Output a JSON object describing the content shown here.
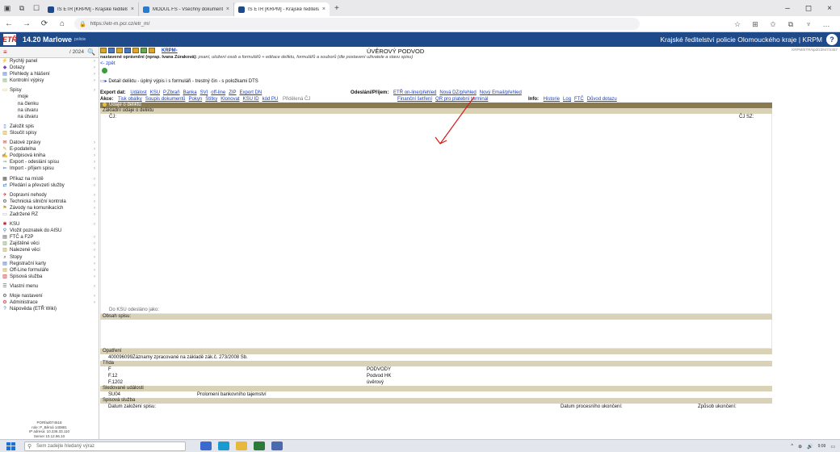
{
  "browser": {
    "tabs": [
      {
        "label": "IS ETŘ [KRPM] - Krajské ředitelst",
        "color": "#1f4a8a",
        "active": false
      },
      {
        "label": "MODUL FŠ - Všechny dokument",
        "color": "#2a7ad0",
        "active": false
      },
      {
        "label": "IS ETŘ [KRPM] - Krajské ředitelst",
        "color": "#1f4a8a",
        "active": true
      }
    ],
    "tab_close": "×",
    "new_tab": "+",
    "url": "https://etr-m.pcr.cz/etr_m/",
    "ctl_icons": [
      "▣",
      "⧉",
      "☐"
    ],
    "nav_icons": [
      "←",
      "→",
      "⟳",
      "⌂"
    ],
    "addr_icons": [
      "☆",
      "⊞",
      "✩",
      "⧉",
      "♆",
      "…"
    ],
    "win": [
      "–",
      "◻",
      "×"
    ]
  },
  "app": {
    "logo": "ETŘ",
    "version": "14.20 Marlowe",
    "police_small": "policie",
    "department": "Krajské ředitelství policie Olomouckého kraje | KRPM",
    "help_icon": "?"
  },
  "sidebar": {
    "menu_icon": "≡",
    "year": "/ 2024",
    "search_icon": "🔍",
    "items": [
      {
        "label": "Rychlý panel",
        "icon": "⚡",
        "color": "#c01818",
        "sub": false,
        "chev": true
      },
      {
        "label": "Dotazy",
        "icon": "◆",
        "color": "#7a3cc0",
        "sub": false,
        "chev": true
      },
      {
        "label": "Přehledy a hlášení",
        "icon": "▤",
        "color": "#2a6ac0",
        "sub": false,
        "chev": true
      },
      {
        "label": "Kontrolní výpisy",
        "icon": "▤",
        "color": "#6aa84f",
        "sub": false,
        "chev": true
      },
      {
        "label": "Spisy",
        "icon": "▭",
        "color": "#c09a28",
        "sub": false,
        "chev": true,
        "gap": true
      },
      {
        "label": "moje",
        "sub": true
      },
      {
        "label": "na členku",
        "sub": true
      },
      {
        "label": "na útvaru",
        "sub": true
      },
      {
        "label": "na útvaru",
        "sub": true
      },
      {
        "label": "Založit spis",
        "icon": "▯",
        "color": "#2a6ac0",
        "sub": false,
        "gap": true
      },
      {
        "label": "Sloučit spisy",
        "icon": "▥",
        "color": "#c09a28",
        "sub": false
      },
      {
        "label": "Datové zprávy",
        "icon": "✉",
        "color": "#c01818",
        "sub": false,
        "chev": true,
        "gap": true
      },
      {
        "label": "E-podatelna",
        "icon": "✎",
        "color": "#c09a28",
        "sub": false,
        "chev": true
      },
      {
        "label": "Podpisová kniha",
        "icon": "✍",
        "color": "#2a6ac0",
        "sub": false,
        "chev": true
      },
      {
        "label": "Export - odeslání spisu",
        "icon": "⇒",
        "color": "#6aa84f",
        "sub": false,
        "chev": true
      },
      {
        "label": "Import - příjem spisu",
        "icon": "⇐",
        "color": "#2a6ac0",
        "sub": false,
        "chev": true
      },
      {
        "label": "Příkaz na místě",
        "icon": "▦",
        "color": "#444",
        "sub": false,
        "chev": true,
        "gap": true
      },
      {
        "label": "Předání a převzetí služby",
        "icon": "⇄",
        "color": "#2a6ac0",
        "sub": false,
        "chev": true
      },
      {
        "label": "Dopravní nehody",
        "icon": "✈",
        "color": "#c01818",
        "sub": false,
        "chev": true,
        "gap": true
      },
      {
        "label": "Technická silniční kontrola",
        "icon": "⚙",
        "color": "#444",
        "sub": false,
        "chev": true
      },
      {
        "label": "Závody na komunikacích",
        "icon": "⚑",
        "color": "#c09a28",
        "sub": false,
        "chev": true
      },
      {
        "label": "Zadržené RZ",
        "icon": "▭",
        "color": "#888",
        "sub": false,
        "chev": true
      },
      {
        "label": "KSU",
        "icon": "✱",
        "color": "#c01818",
        "sub": false,
        "chev": true,
        "gap": true
      },
      {
        "label": "Vložit poznatek do AISU",
        "icon": "⚲",
        "color": "#2a6ac0",
        "sub": false
      },
      {
        "label": "FTČ a F2P",
        "icon": "▤",
        "color": "#444",
        "sub": false,
        "chev": true
      },
      {
        "label": "Zajištěné věci",
        "icon": "▨",
        "color": "#6aa84f",
        "sub": false,
        "chev": true
      },
      {
        "label": "Nalezené věci",
        "icon": "▨",
        "color": "#c09a28",
        "sub": false,
        "chev": true
      },
      {
        "label": "Stopy",
        "icon": "⌕",
        "color": "#444",
        "sub": false,
        "chev": true
      },
      {
        "label": "Registrační karty",
        "icon": "▤",
        "color": "#2a6ac0",
        "sub": false,
        "chev": true
      },
      {
        "label": "Off-Line formuláře",
        "icon": "▤",
        "color": "#c09a28",
        "sub": false,
        "chev": true
      },
      {
        "label": "Spisová služba",
        "icon": "▥",
        "color": "#c01818",
        "sub": false,
        "chev": true
      },
      {
        "label": "Vlastní menu",
        "icon": "☰",
        "color": "#2a6ac0",
        "sub": false,
        "chev": true,
        "gap": true
      },
      {
        "label": "Moje nastavení",
        "icon": "⚙",
        "color": "#444",
        "sub": false,
        "chev": true,
        "gap": true
      },
      {
        "label": "Administrace",
        "icon": "⚙",
        "color": "#c01818",
        "sub": false,
        "chev": true
      },
      {
        "label": "Nápověda (ETŘ Wiki)",
        "icon": "?",
        "color": "#2a6ac0",
        "sub": false
      }
    ],
    "footer": [
      "PORfad074618",
      "role: P_Běrná 140881",
      "IP adresa: 10.236.33.110",
      "Server 10.12.96.10"
    ]
  },
  "main": {
    "krpm": "KRPM-",
    "title": "ÚVĚROVÝ PODVOD",
    "rcode": "KRPM/ETR/spd/23847/2457",
    "perm_bold": "nastavené oprávnění (nprap. Ivana Zúraková):",
    "perm_rest": "psaní, uložení osob a formulářů + editace deliktu, formulářů a souborů (dle postavení uživatele a stavu spisu)",
    "back": "<- zpět",
    "detail": "Detail deliktu - úplný výpis i s formuláři - trestný čin - s položkami DTS",
    "export_label": "Export dat:",
    "export_links": [
      "Událost",
      "KSU",
      "P.Zbraň",
      "Banka",
      "SVI",
      "off-line",
      "ZIP",
      "Export DN"
    ],
    "akce_label": "Akce:",
    "akce_links": [
      "Tisk obálky",
      "Soupis dokumentů",
      "Pokyn",
      "Štítky",
      "Klonovat",
      "KSU ID",
      "kód PU"
    ],
    "akce_grey": "Přidělená ČJ",
    "odes_label": "Odeslání/Příjem:",
    "odes_links": [
      "ETŘ on-line/přehled",
      "Nová DZ/přehled",
      "Nový Email/přehled"
    ],
    "odes_links2": [
      "Finanční šetření",
      "QR pro platební terminál"
    ],
    "info_label": "Info:",
    "info_links": [
      "Historie",
      "Log",
      "FTČ",
      "Důvod dotazu"
    ],
    "sec_udaje": "Údaje o deliktu",
    "sec_zakladni": "Základní údaje o deliktu",
    "cj": "ČJ:",
    "cjsz": "ČJ SZ:",
    "do_ksu": "Do KSU odesláno jako:",
    "sec_obsah": "Obsah spisu:",
    "sec_opatreni": "Opatření",
    "opatreni_text": "400096099Záznamy zpracované na základě zák.č. 273/2008 Sb.",
    "sec_trida": "Třída",
    "trida_rows": [
      [
        "F",
        "PODVODY"
      ],
      [
        "F.12",
        "Podvod HK"
      ],
      [
        "F.1202",
        "úvěrový"
      ]
    ],
    "sec_sled": "Sledované události",
    "sled_code": "SU04",
    "sled_text": "Prolomení bankovního tajemství",
    "sec_spisova": "Spisová služba",
    "datum_zalozeni": "Datum založení spisu:",
    "datum_proc": "Datum procesního ukončení:",
    "zpusob": "Způsob ukončení:"
  },
  "taskbar": {
    "search_icon": "⚲",
    "search": "Sem zadejte hledaný výraz",
    "apps": [
      {
        "color": "#3a6ad0"
      },
      {
        "color": "#1a9ad0"
      },
      {
        "color": "#e8b83a"
      },
      {
        "color": "#2a7a3a"
      },
      {
        "color": "#4a6ab0"
      }
    ],
    "tray": [
      "^",
      "⊕",
      "🔊"
    ],
    "time": "9:09",
    "date": "",
    "notif": "▭"
  }
}
